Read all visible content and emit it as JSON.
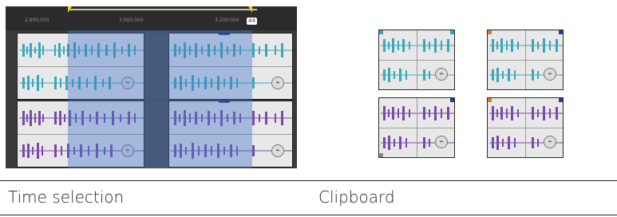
{
  "ruler": {
    "tick_labels": [
      "2,800,000",
      "3,000,000",
      "3,200,000"
    ],
    "end_handle": "44"
  },
  "colors": {
    "teal_wave": "#39a8b8",
    "purple_wave": "#7a4aa8",
    "selection": "#4678c8"
  },
  "icons": {
    "crossfade": "crossfade-icon"
  },
  "captions": {
    "time_selection": "Time selection",
    "clipboard": "Clipboard"
  }
}
